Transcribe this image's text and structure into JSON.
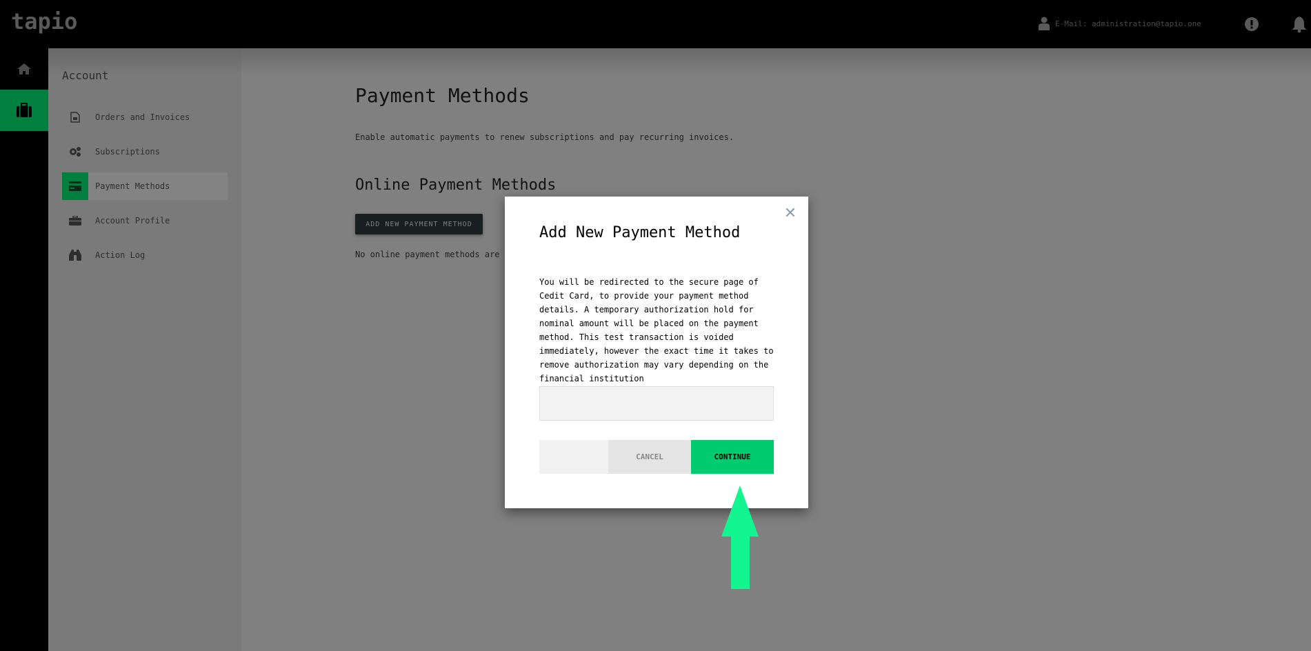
{
  "header": {
    "logo": "tapio",
    "user_label": "E-Mail: administration@tapio.one",
    "icons": [
      "user-icon",
      "alert-icon",
      "bell-icon"
    ]
  },
  "rail": {
    "items": [
      {
        "name": "home",
        "icon": "home-icon",
        "active": false
      },
      {
        "name": "account",
        "icon": "briefcase-icon",
        "active": true
      }
    ]
  },
  "sidebar": {
    "title": "Account",
    "items": [
      {
        "label": "Orders and Invoices",
        "icon": "document-icon",
        "active": false
      },
      {
        "label": "Subscriptions",
        "icon": "gears-icon",
        "active": false
      },
      {
        "label": "Payment Methods",
        "icon": "credit-card-icon",
        "active": true
      },
      {
        "label": "Account Profile",
        "icon": "briefcase-icon",
        "active": false
      },
      {
        "label": "Action Log",
        "icon": "binoculars-icon",
        "active": false
      }
    ]
  },
  "main": {
    "title": "Payment Methods",
    "description": "Enable automatic payments to renew subscriptions and pay recurring invoices.",
    "section_title": "Online Payment Methods",
    "add_button": "ADD NEW PAYMENT METHOD",
    "empty_note": "No online payment methods are s"
  },
  "modal": {
    "title": "Add New Payment Method",
    "text": "You will be redirected to the secure page of Cedit Card, to provide your payment method details. A temporary authorization hold for nominal amount will be placed on the payment method. This test transaction is voided immediately, however the exact time it takes to remove authorization may vary depending on the financial institution",
    "input_value": "",
    "cancel_label": "CANCEL",
    "continue_label": "CONTINUE",
    "close_icon": "close-icon"
  },
  "annotation": {
    "arrow_color": "#12F58F",
    "points_to": "continue-button"
  },
  "colors": {
    "accent": "#00CC6F",
    "active_dark": "#007F3F",
    "header_bg": "#000000"
  }
}
